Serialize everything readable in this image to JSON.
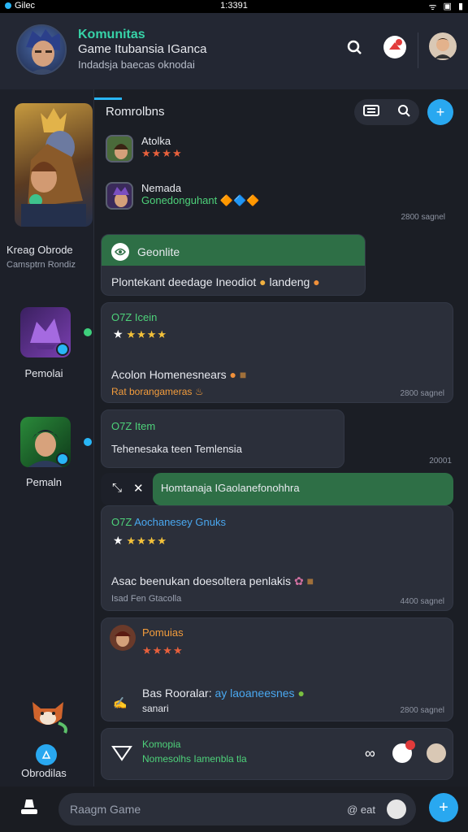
{
  "status": {
    "app": "Gilec",
    "time": "1:3391"
  },
  "header": {
    "title": "Komunitas",
    "subtitle": "Game Itubansia IGanca",
    "subtitle2": "Indadsja baecas oknodai"
  },
  "sidebar": {
    "hero_name": "Kreag Obrode",
    "hero_sub": "Camsptrn Rondiz",
    "items": [
      {
        "label": "Pemolai"
      },
      {
        "label": "Pemaln"
      }
    ],
    "bottom_label": "Obrodilas"
  },
  "main": {
    "title": "Romrolbns",
    "players": [
      {
        "name": "Atolka",
        "rating": "★★★★",
        "note": ""
      },
      {
        "name": "Nemada",
        "note": "Gonedonguhant",
        "emojis": "🔶🔷🔶"
      }
    ],
    "meta1": "2800 sagnel",
    "cards": [
      {
        "header": "Geonlite",
        "body": "Plontekant deedage Ineodiot",
        "body_tail": "landeng"
      },
      {
        "tag": "O7Z",
        "label": "Icein",
        "rating": "★★★★",
        "body": "Acolon Homenesnears",
        "sub": "Rat borangameras",
        "meta": "2800 sagnel"
      },
      {
        "tag": "O7Z",
        "label": "Item",
        "body": "Tehenesaka teen Temlensia",
        "meta": "20001"
      },
      {
        "header": "Homtanaja IGaolanefonohhra"
      },
      {
        "tag": "O7Z",
        "label": "Aochanesey Gnuks",
        "rating": "★★★★",
        "body": "Asac beenukan doesoltera penlakis",
        "sub": "Isad Fen Gtacolla",
        "meta": "4400 sagnel"
      },
      {
        "name": "Pomuias",
        "rating": "★★★★",
        "body": "Bas Rooralar:",
        "body_tail": "ay laoaneesnes",
        "sub": "sanari",
        "meta": "2800 sagnel"
      },
      {
        "title": "Komopia",
        "sub": "Nomesolhs Iamenbla tla"
      }
    ]
  },
  "composer": {
    "placeholder": "Raagm Game",
    "right_label": "@ eat"
  },
  "colors": {
    "accent": "#29a8f0",
    "green": "#2e6f46",
    "title_teal": "#37d3a8"
  }
}
